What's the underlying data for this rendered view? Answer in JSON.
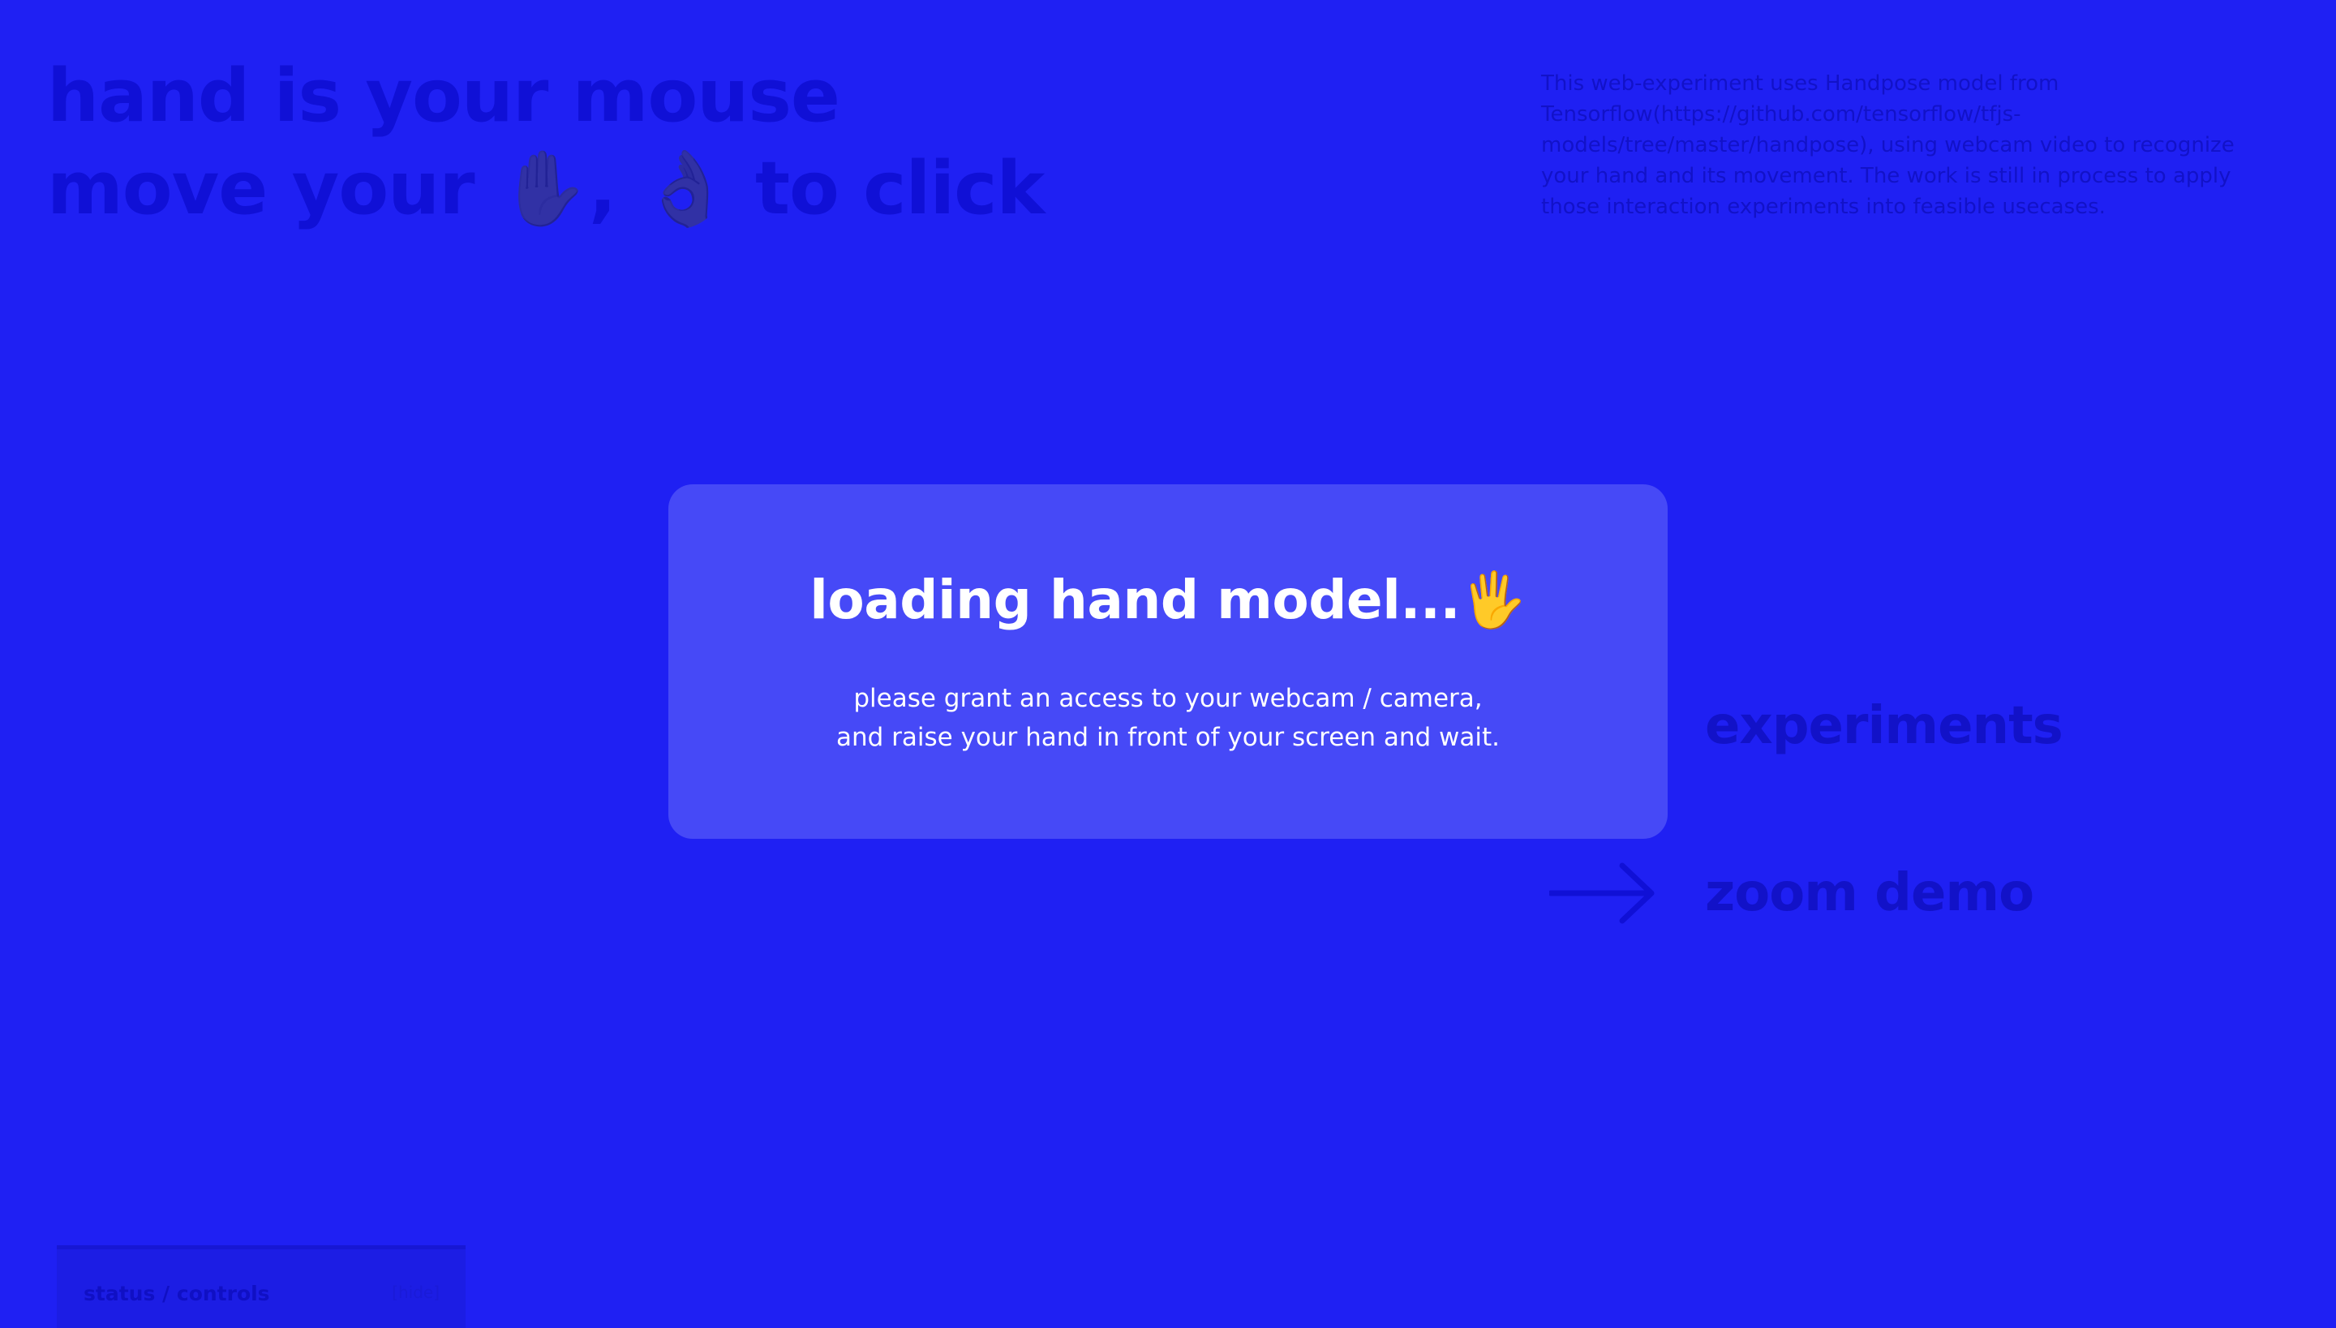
{
  "header": {
    "line1": "hand is your mouse",
    "line2_prefix": "move your ",
    "line2_hand_emoji": "✋",
    "line2_separator": ", ",
    "line2_ok_emoji": "👌",
    "line2_suffix": " to click"
  },
  "description": "This web-experiment uses Handpose model from Tensorflow(https://github.com/tensorflow/tfjs-models/tree/master/handpose), using webcam video to recognize your hand and its movement. The work is still in process to apply those interaction experiments into feasible usecases.",
  "nav": {
    "items": [
      {
        "label": "experiments",
        "icon": "arrow-right-icon"
      },
      {
        "label": "zoom demo",
        "icon": "arrow-right-icon"
      }
    ]
  },
  "modal": {
    "title": "loading hand model...",
    "title_emoji": "🖐",
    "line1": "please grant an access to your webcam / camera,",
    "line2": "and raise your hand in front of your screen and wait."
  },
  "status": {
    "title": "status / controls",
    "toggle": "[hide]"
  },
  "colors": {
    "background": "#1f20f3",
    "modal": "#4649f7",
    "text_dim": "#1212c8",
    "modal_text": "#ffffff"
  }
}
